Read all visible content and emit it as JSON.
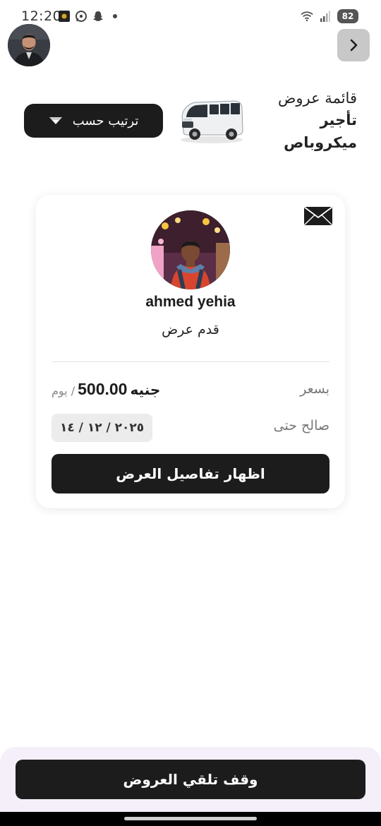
{
  "status_bar": {
    "time": "12:20",
    "battery": "82",
    "icons": [
      "app-icon",
      "whatsapp-icon",
      "snapchat-icon",
      "dot-icon",
      "wifi-icon",
      "signal-icon",
      "battery-icon"
    ]
  },
  "header": {
    "title_line1": "قائمة عروض",
    "title_line2": "تأجير",
    "title_line3": "ميكروباص",
    "sort_label": "ترتيب حسب"
  },
  "offer": {
    "name": "ahmed yehia",
    "subtitle": "قدم عرض",
    "price_label": "بسعر",
    "price_amount": "500.00",
    "price_currency": "جنيه",
    "price_unit": "/ يوم",
    "valid_label": "صالح حتى",
    "valid_date": "٢٠٢٥ / ١٢ / ١٤",
    "details_button": "اظهار تفاصيل العرض"
  },
  "footer": {
    "stop_button": "وقف تلقي العروض"
  },
  "colors": {
    "primary": "#1c1c1c",
    "bottom_panel": "#f4eff8",
    "back_button": "#c8c8c8"
  }
}
